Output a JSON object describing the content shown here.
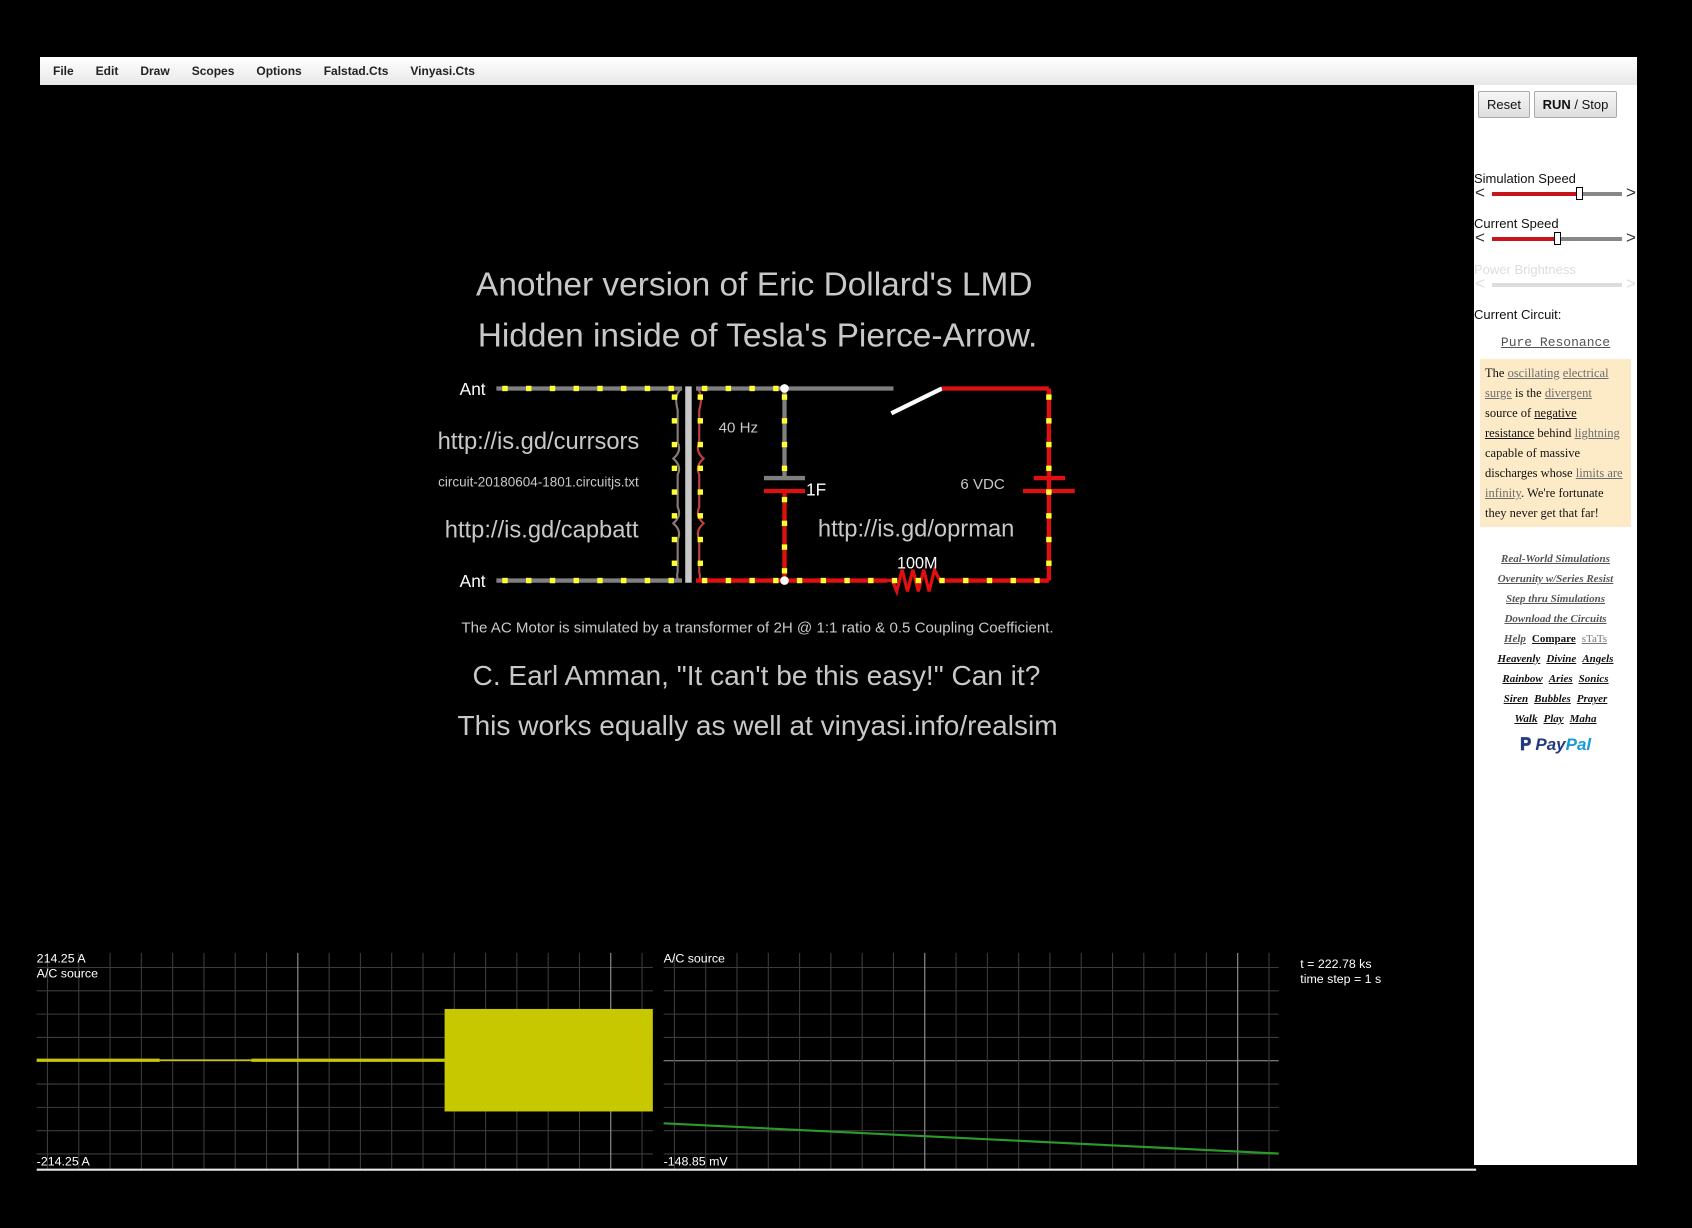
{
  "menu": [
    "File",
    "Edit",
    "Draw",
    "Scopes",
    "Options",
    "Falstad.Cts",
    "Vinyasi.Cts"
  ],
  "buttons": {
    "reset": "Reset",
    "run": "RUN",
    "run_sep": " / ",
    "stop": "Stop"
  },
  "panel": {
    "sim_speed_label": "Simulation Speed",
    "sim_speed_value": 0.67,
    "current_speed_label": "Current Speed",
    "current_speed_value": 0.5,
    "power_brightness_label": "Power Brightness",
    "current_circuit_label": "Current Circuit:",
    "circuit_name": "Pure Resonance",
    "description": [
      {
        "text": "The ",
        "link": ""
      },
      {
        "text": "oscillating",
        "link": "gray"
      },
      {
        "text": " ",
        "link": ""
      },
      {
        "text": "electrical surge",
        "link": "gray"
      },
      {
        "text": " is the ",
        "link": ""
      },
      {
        "text": "divergent",
        "link": "gray"
      },
      {
        "text": " source of ",
        "link": ""
      },
      {
        "text": "negative resistance",
        "link": "dark"
      },
      {
        "text": " behind ",
        "link": ""
      },
      {
        "text": "lightning",
        "link": "gray"
      },
      {
        "text": " capable of massive discharges whose ",
        "link": ""
      },
      {
        "text": "limits are infinity",
        "link": "gray"
      },
      {
        "text": ". We're fortunate they never get that far!",
        "link": ""
      }
    ],
    "links": [
      [
        {
          "text": "Real-World Simulations",
          "style": "gray"
        }
      ],
      [
        {
          "text": "Overunity w/Series Resist",
          "style": "gray"
        }
      ],
      [
        {
          "text": "Step thru Simulations",
          "style": "gray"
        }
      ],
      [
        {
          "text": "Download the Circuits",
          "style": "gray"
        }
      ],
      [
        {
          "text": "Help",
          "style": "gray"
        },
        {
          "text": "Compare",
          "style": "darkup"
        },
        {
          "text": "sTaTs",
          "style": "plain"
        }
      ],
      [
        {
          "text": "Heavenly",
          "style": "dark"
        },
        {
          "text": "Divine",
          "style": "dark"
        },
        {
          "text": "Angels",
          "style": "dark"
        }
      ],
      [
        {
          "text": "Rainbow",
          "style": "dark"
        },
        {
          "text": "Aries",
          "style": "dark"
        },
        {
          "text": "Sonics",
          "style": "dark"
        }
      ],
      [
        {
          "text": "Siren",
          "style": "dark"
        },
        {
          "text": "Bubbles",
          "style": "dark"
        },
        {
          "text": "Prayer",
          "style": "dark"
        }
      ],
      [
        {
          "text": "Walk",
          "style": "dark"
        },
        {
          "text": "Play",
          "style": "dark"
        },
        {
          "text": "Maha",
          "style": "dark"
        }
      ]
    ],
    "paypal": {
      "p1": "Pay",
      "p2": "Pal"
    }
  },
  "canvas": {
    "title1": "Another version of Eric Dollard's LMD",
    "title2": "Hidden inside of Tesla's Pierce-Arrow.",
    "ant_top": "Ant",
    "ant_bottom": "Ant",
    "url1": "http://is.gd/currsors",
    "filename": "circuit-20180604-1801.circuitjs.txt",
    "url2": "http://is.gd/capbatt",
    "url3": "http://is.gd/oprman",
    "freq": "40 Hz",
    "cap": "1F",
    "battery": "6 VDC",
    "resistor": "100M",
    "note": "The AC Motor is simulated by a transformer of 2H @ 1:1 ratio & 0.5 Coupling Coefficient.",
    "quote": "C. Earl Amman, \"It can't be this easy!\" Can it?",
    "footer": "This works equally as well at vinyasi.info/realsim"
  },
  "scopes": [
    {
      "max": "214.25 A",
      "name": "A/C source",
      "min": "-214.25 A",
      "color": "#c8c800"
    },
    {
      "name": "A/C source",
      "min": "-148.85 mV",
      "color": "#2a9a2a"
    }
  ],
  "time": {
    "t": "t = 222.78 ks",
    "step": "time step = 1 s"
  },
  "colors": {
    "wire": "#7f7f7f",
    "current": "#ffff33",
    "hot": "#e01010",
    "background": "#000000"
  }
}
